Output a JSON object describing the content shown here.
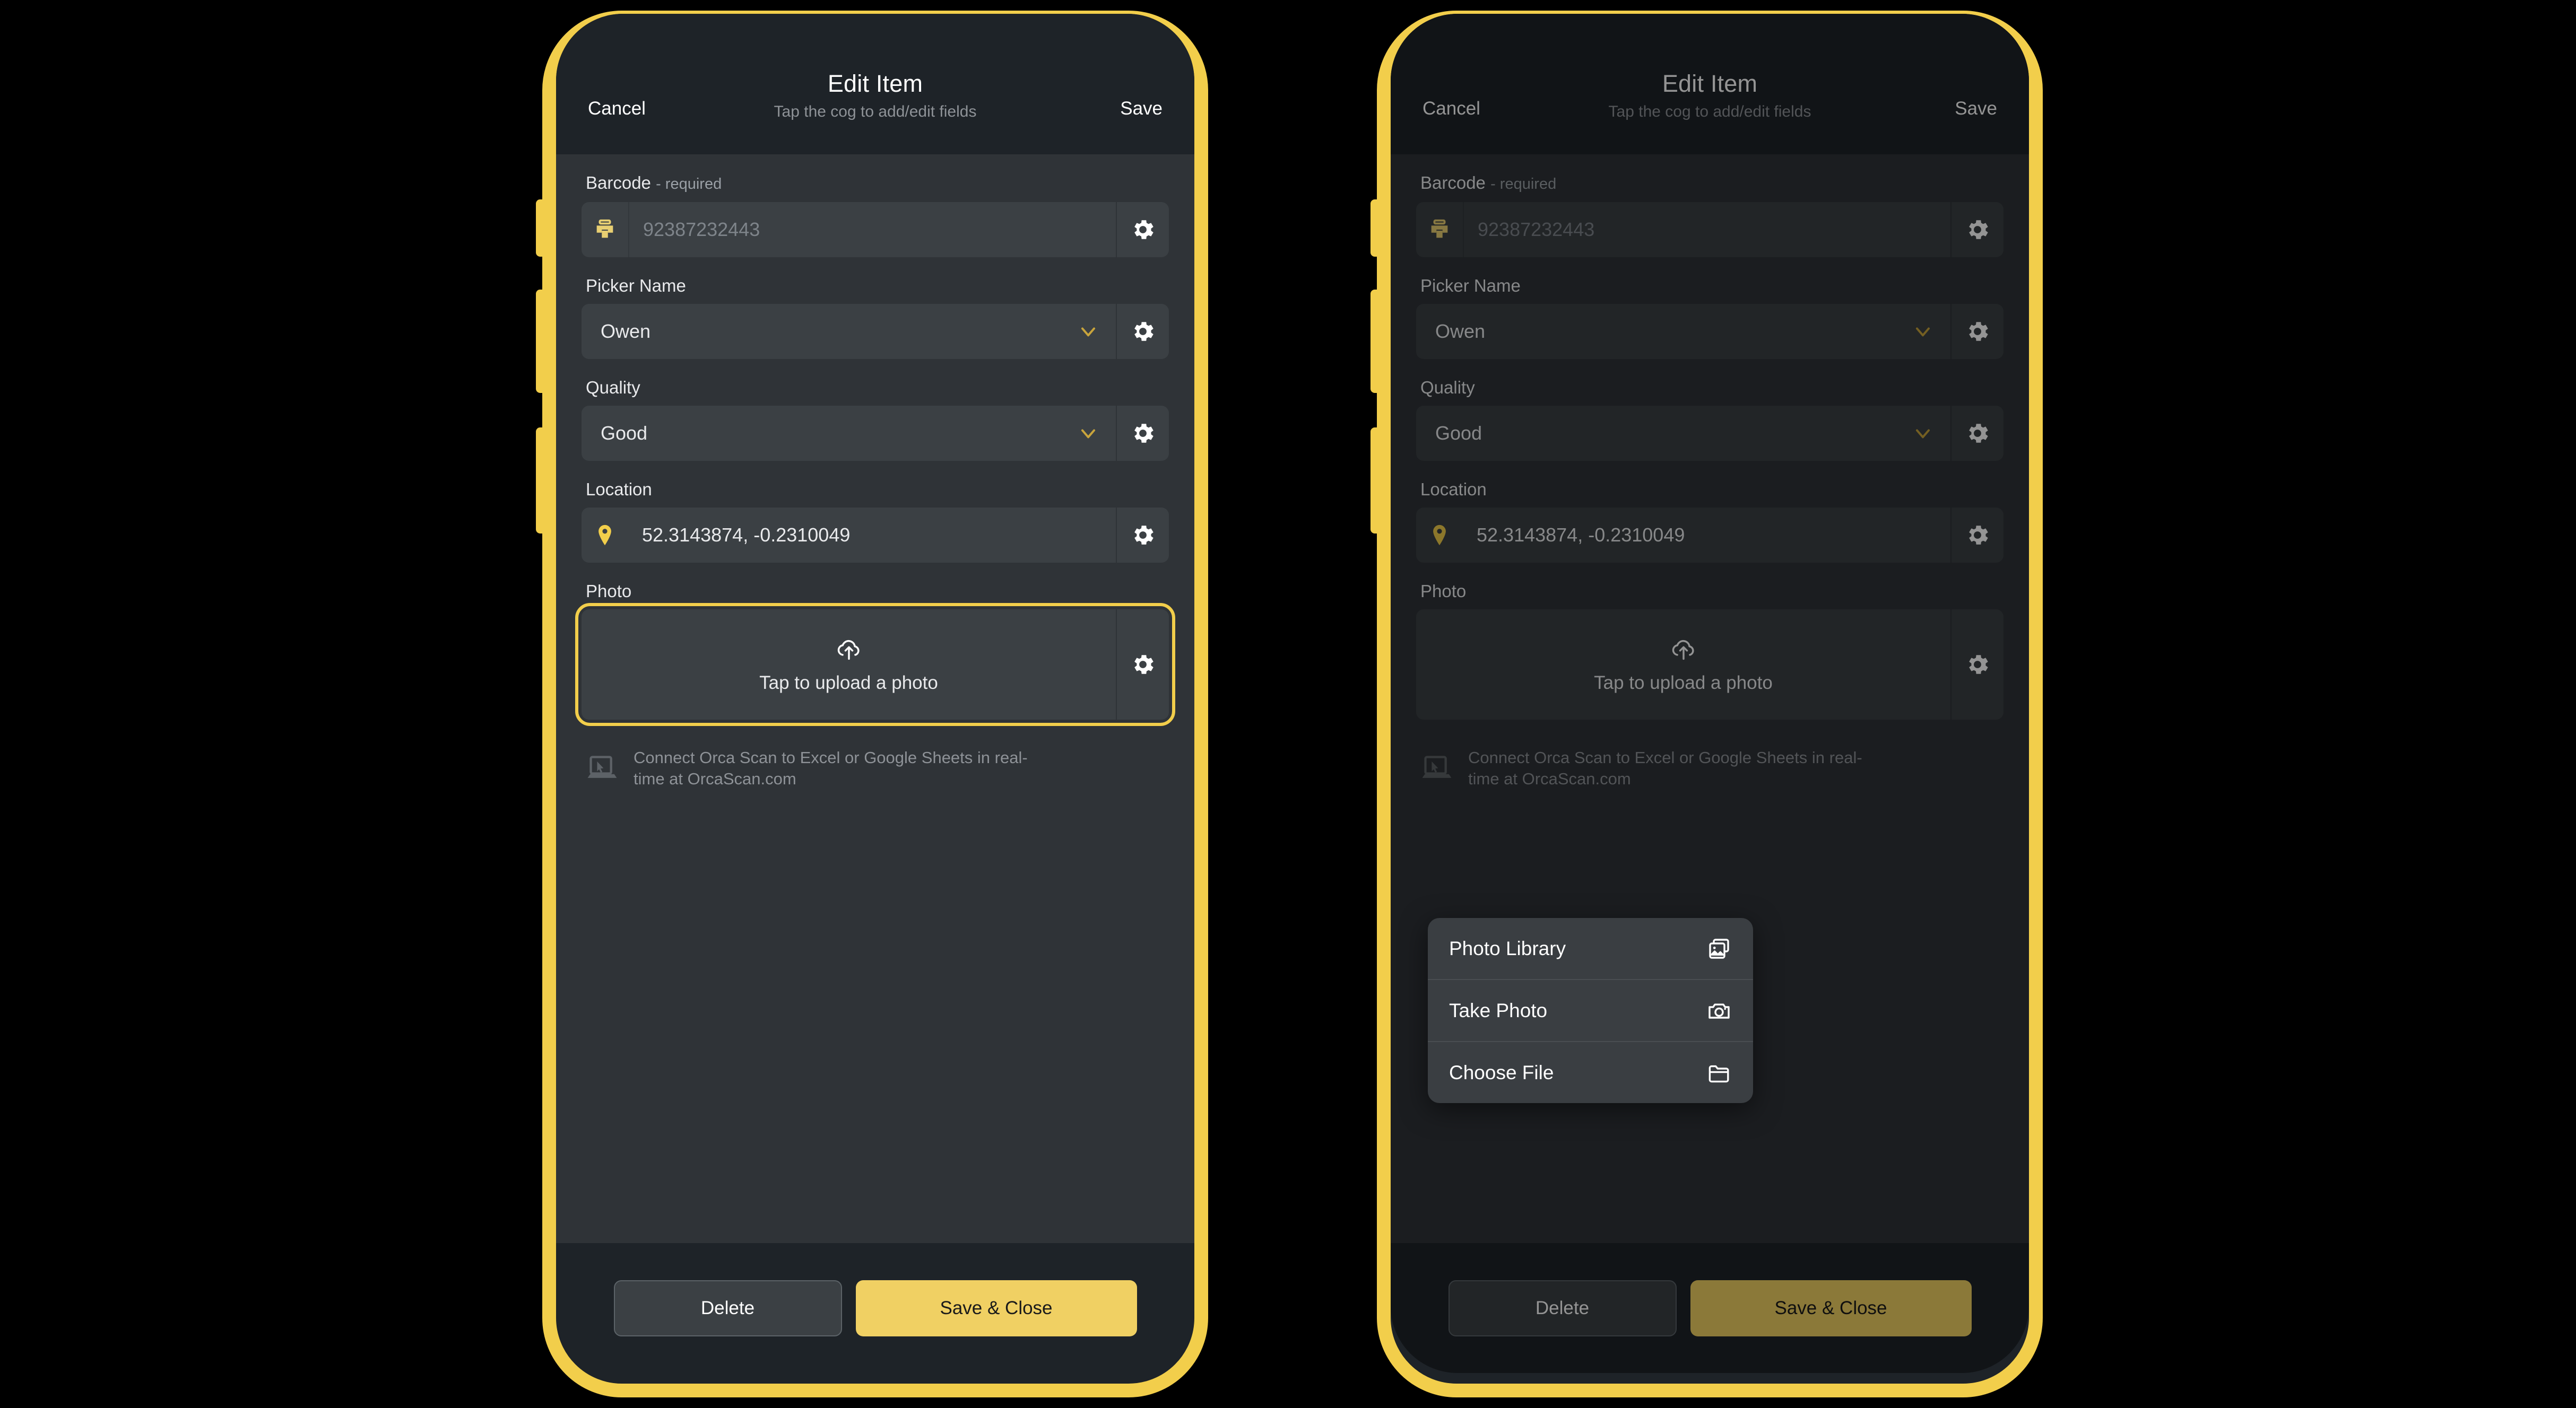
{
  "theme": {
    "accent": "#f2ce4b",
    "frame": "#f2ce4b",
    "screen_bg": "#2f3337",
    "header_bg": "#1e2328",
    "field_bg": "#3b4044",
    "text": "#e9eaec",
    "muted": "#8e9297",
    "save_btn_bg": "#f0d063"
  },
  "header": {
    "cancel_label": "Cancel",
    "title": "Edit Item",
    "subtitle": "Tap the cog to add/edit fields",
    "save_label": "Save"
  },
  "fields": {
    "barcode": {
      "label": "Barcode",
      "required_suffix": "- required",
      "value": "92387232443",
      "icon": "barcode-scanner-icon",
      "cog_icon": "gear-icon"
    },
    "picker_name": {
      "label": "Picker Name",
      "value": "Owen",
      "chevron_icon": "chevron-down-icon",
      "cog_icon": "gear-icon"
    },
    "quality": {
      "label": "Quality",
      "value": "Good",
      "chevron_icon": "chevron-down-icon",
      "cog_icon": "gear-icon"
    },
    "location": {
      "label": "Location",
      "value": "52.3143874, -0.2310049",
      "icon": "map-pin-icon",
      "cog_icon": "gear-icon"
    },
    "photo": {
      "label": "Photo",
      "upload_text": "Tap to upload a photo",
      "upload_icon": "cloud-upload-icon",
      "cog_icon": "gear-icon"
    }
  },
  "promo": {
    "icon": "laptop-cursor-icon",
    "text": "Connect Orca Scan to Excel or Google Sheets in real-time at OrcaScan.com"
  },
  "footer": {
    "delete_label": "Delete",
    "save_close_label": "Save & Close"
  },
  "photo_menu": {
    "items": [
      {
        "label": "Photo Library",
        "icon": "photo-library-icon"
      },
      {
        "label": "Take Photo",
        "icon": "camera-icon"
      },
      {
        "label": "Choose File",
        "icon": "folder-icon"
      }
    ]
  }
}
